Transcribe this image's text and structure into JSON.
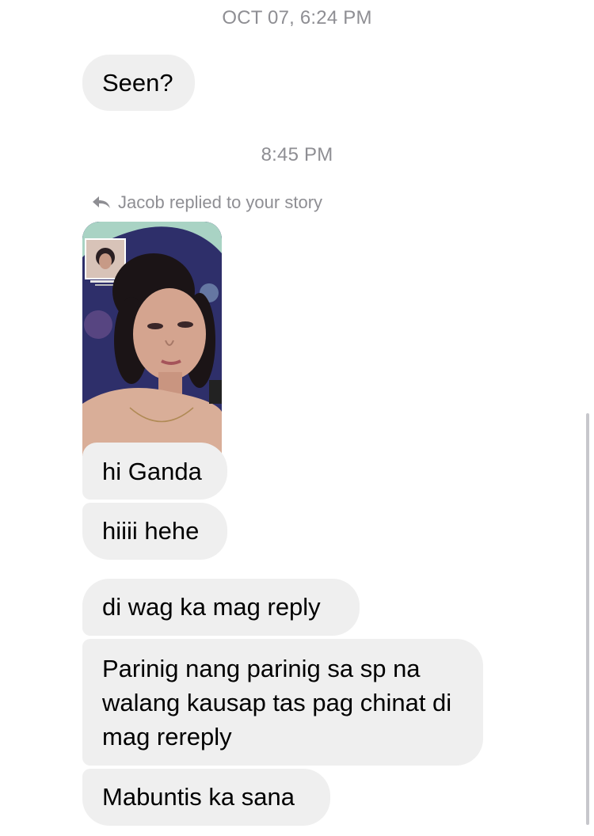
{
  "thread": {
    "timestamp_1": "OCT 07, 6:24 PM",
    "timestamp_2": "8:45 PM",
    "reply_note": "Jacob replied to your story",
    "messages": [
      {
        "text": "Seen?"
      },
      {
        "text": "hi Ganda"
      },
      {
        "text": "hiiii hehe"
      },
      {
        "text": "di wag ka mag reply"
      },
      {
        "text": "Parinig nang parinig sa sp na walang kausap tas pag chinat di mag rereply"
      },
      {
        "text": "Mabuntis ka sana"
      }
    ]
  },
  "icons": {
    "reply": "reply-arrow-icon"
  },
  "colors": {
    "bubble": "#efefef",
    "meta_text": "#8e8e93",
    "background": "#ffffff"
  }
}
